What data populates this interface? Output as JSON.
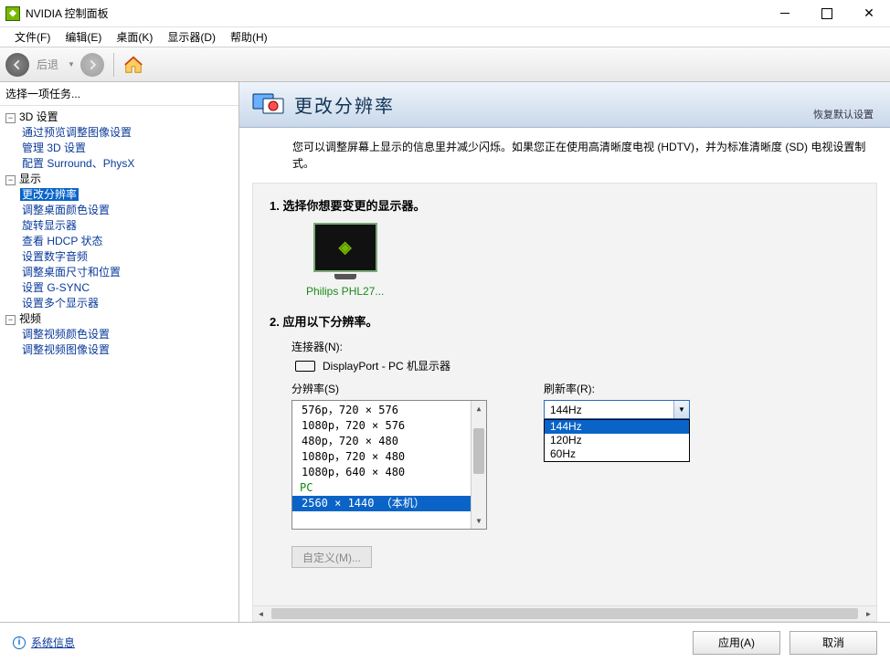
{
  "window": {
    "title": "NVIDIA 控制面板"
  },
  "menu": [
    "文件(F)",
    "编辑(E)",
    "桌面(K)",
    "显示器(D)",
    "帮助(H)"
  ],
  "toolbar": {
    "back_label": "后退"
  },
  "sidebar": {
    "header": "选择一项任务...",
    "tree": {
      "cat_3d": "3D 设置",
      "items_3d": [
        "通过预览调整图像设置",
        "管理 3D 设置",
        "配置 Surround、PhysX"
      ],
      "cat_display": "显示",
      "items_display": [
        "更改分辨率",
        "调整桌面颜色设置",
        "旋转显示器",
        "查看 HDCP 状态",
        "设置数字音频",
        "调整桌面尺寸和位置",
        "设置 G-SYNC",
        "设置多个显示器"
      ],
      "cat_video": "视频",
      "items_video": [
        "调整视频颜色设置",
        "调整视频图像设置"
      ]
    }
  },
  "content": {
    "title": "更改分辨率",
    "restore": "恢复默认设置",
    "desc": "您可以调整屏幕上显示的信息里并减少闪烁。如果您正在使用高清晰度电视 (HDTV)，并为标准清晰度 (SD) 电视设置制式。",
    "step1_h": "1.  选择你想要变更的显示器。",
    "monitor_label": "Philips PHL27...",
    "step2_h": "2.  应用以下分辨率。",
    "connector_label": "连接器(N):",
    "connector_value": "DisplayPort - PC 机显示器",
    "resolution_label": "分辨率(S)",
    "refresh_label": "刷新率(R):",
    "resolutions": {
      "items": [
        "576p，720 × 576",
        "1080p，720 × 576",
        "480p，720 × 480",
        "1080p，720 × 480",
        "1080p，640 × 480"
      ],
      "group": "PC",
      "selected": "2560 × 1440 （本机）"
    },
    "refresh": {
      "selected": "144Hz",
      "options": [
        "144Hz",
        "120Hz",
        "60Hz"
      ]
    },
    "custom_btn": "自定义(M)..."
  },
  "bottom": {
    "sysinfo": "系统信息",
    "apply": "应用(A)",
    "cancel": "取消"
  }
}
